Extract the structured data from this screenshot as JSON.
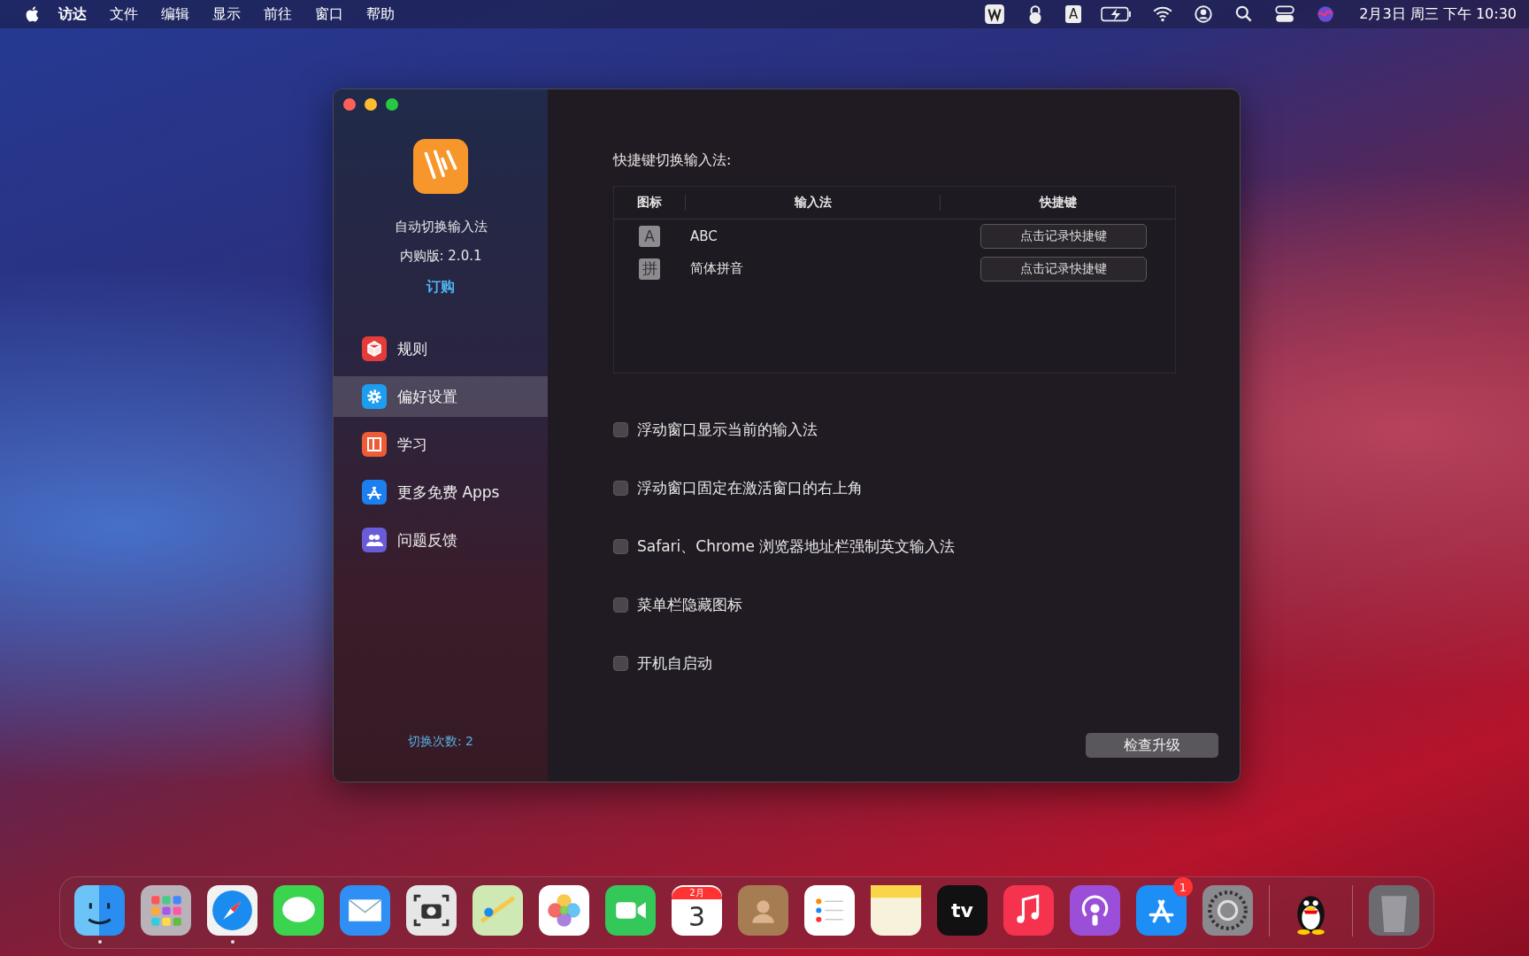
{
  "menu_bar": {
    "menus": [
      {
        "label": "访达",
        "kind": "app"
      },
      {
        "label": "文件",
        "kind": "menu"
      },
      {
        "label": "编辑",
        "kind": "menu"
      },
      {
        "label": "显示",
        "kind": "menu"
      },
      {
        "label": "前往",
        "kind": "menu"
      },
      {
        "label": "窗口",
        "kind": "menu"
      },
      {
        "label": "帮助",
        "kind": "menu"
      }
    ],
    "status": [
      {
        "kind": "app-w"
      },
      {
        "kind": "lock"
      },
      {
        "kind": "input",
        "text": "A"
      },
      {
        "kind": "battery"
      },
      {
        "kind": "wifi"
      },
      {
        "kind": "user"
      },
      {
        "kind": "search"
      },
      {
        "kind": "control"
      },
      {
        "kind": "siri"
      }
    ],
    "clock": "2月3日 周三 下午 10:30"
  },
  "window": {
    "sidebar": {
      "app_name": "自动切换输入法",
      "version": "内购版: 2.0.1",
      "purchase_link": "订购",
      "items": [
        {
          "label": "规则",
          "kind": "rules",
          "selected": false
        },
        {
          "label": "偏好设置",
          "kind": "prefs",
          "selected": true
        },
        {
          "label": "学习",
          "kind": "learn",
          "selected": false
        },
        {
          "label": "更多免费 Apps",
          "kind": "apps",
          "selected": false
        },
        {
          "label": "问题反馈",
          "kind": "feedback",
          "selected": false
        }
      ],
      "switch_count": "切换次数: 2"
    },
    "content": {
      "section_title": "快捷键切换输入法:",
      "table": {
        "columns": [
          "图标",
          "输入法",
          "快捷键"
        ],
        "rows": [
          {
            "icon": "A",
            "name": "ABC",
            "shortcut": "点击记录快捷键"
          },
          {
            "icon": "拼",
            "name": "简体拼音",
            "shortcut": "点击记录快捷键"
          }
        ]
      },
      "options": [
        {
          "label": "浮动窗口显示当前的输入法",
          "checked": false
        },
        {
          "label": "浮动窗口固定在激活窗口的右上角",
          "checked": false
        },
        {
          "label": "Safari、Chrome 浏览器地址栏强制英文输入法",
          "checked": false
        },
        {
          "label": "菜单栏隐藏图标",
          "checked": false
        },
        {
          "label": "开机自启动",
          "checked": false
        }
      ],
      "update_button": "检查升级"
    }
  },
  "dock": [
    {
      "kind": "finder",
      "running": true
    },
    {
      "kind": "launchpad",
      "running": false
    },
    {
      "kind": "safari",
      "running": true
    },
    {
      "kind": "messages",
      "running": false
    },
    {
      "kind": "mail",
      "running": false
    },
    {
      "kind": "screenshot",
      "running": false
    },
    {
      "kind": "maps",
      "running": false
    },
    {
      "kind": "photos",
      "running": false
    },
    {
      "kind": "facetime",
      "running": false
    },
    {
      "kind": "calendar",
      "running": false,
      "month": "2月",
      "day": "3"
    },
    {
      "kind": "contacts",
      "running": false
    },
    {
      "kind": "reminders",
      "running": false
    },
    {
      "kind": "notes",
      "running": false
    },
    {
      "kind": "tv",
      "running": false,
      "text": "tv"
    },
    {
      "kind": "music",
      "running": false
    },
    {
      "kind": "podcasts",
      "running": false
    },
    {
      "kind": "appstore",
      "running": false,
      "badge": "1"
    },
    {
      "kind": "settings",
      "running": false
    },
    {
      "kind": "separator"
    },
    {
      "kind": "qq",
      "running": false
    },
    {
      "kind": "separator"
    },
    {
      "kind": "trash",
      "running": false
    }
  ]
}
